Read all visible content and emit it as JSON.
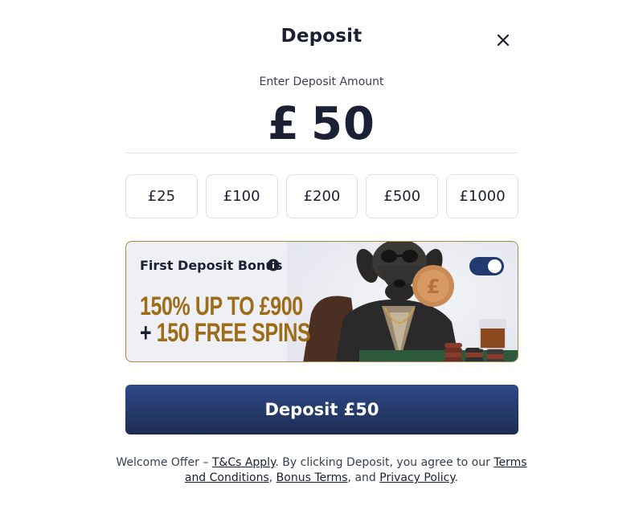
{
  "modal": {
    "title": "Deposit",
    "close_icon": "close-icon"
  },
  "amount": {
    "label": "Enter Deposit Amount",
    "currency": "£",
    "value": "50"
  },
  "presets": [
    "£25",
    "£100",
    "£200",
    "£500",
    "£1000"
  ],
  "bonus": {
    "title": "First Deposit Bonus",
    "info_icon": "info-icon",
    "promo_line1_a": "150% UP TO ",
    "promo_line1_b": "£900",
    "promo_line2_a": "+ ",
    "promo_line2_b": "150 FREE SPINS",
    "toggle_on": true
  },
  "deposit_button": {
    "label": "Deposit £50"
  },
  "footer": {
    "t1": "Welcome Offer – ",
    "l1": "T&Cs Apply",
    "t2": ". By clicking Deposit, you agree to our ",
    "l2": "Terms and Conditions",
    "t3": ", ",
    "l3": "Bonus Terms",
    "t4": ", and ",
    "l4": "Privacy Policy",
    "t5": "."
  },
  "colors": {
    "brand_navy": "#1d2c52",
    "gold": "#9e6b17",
    "card_border": "#a8864f"
  }
}
